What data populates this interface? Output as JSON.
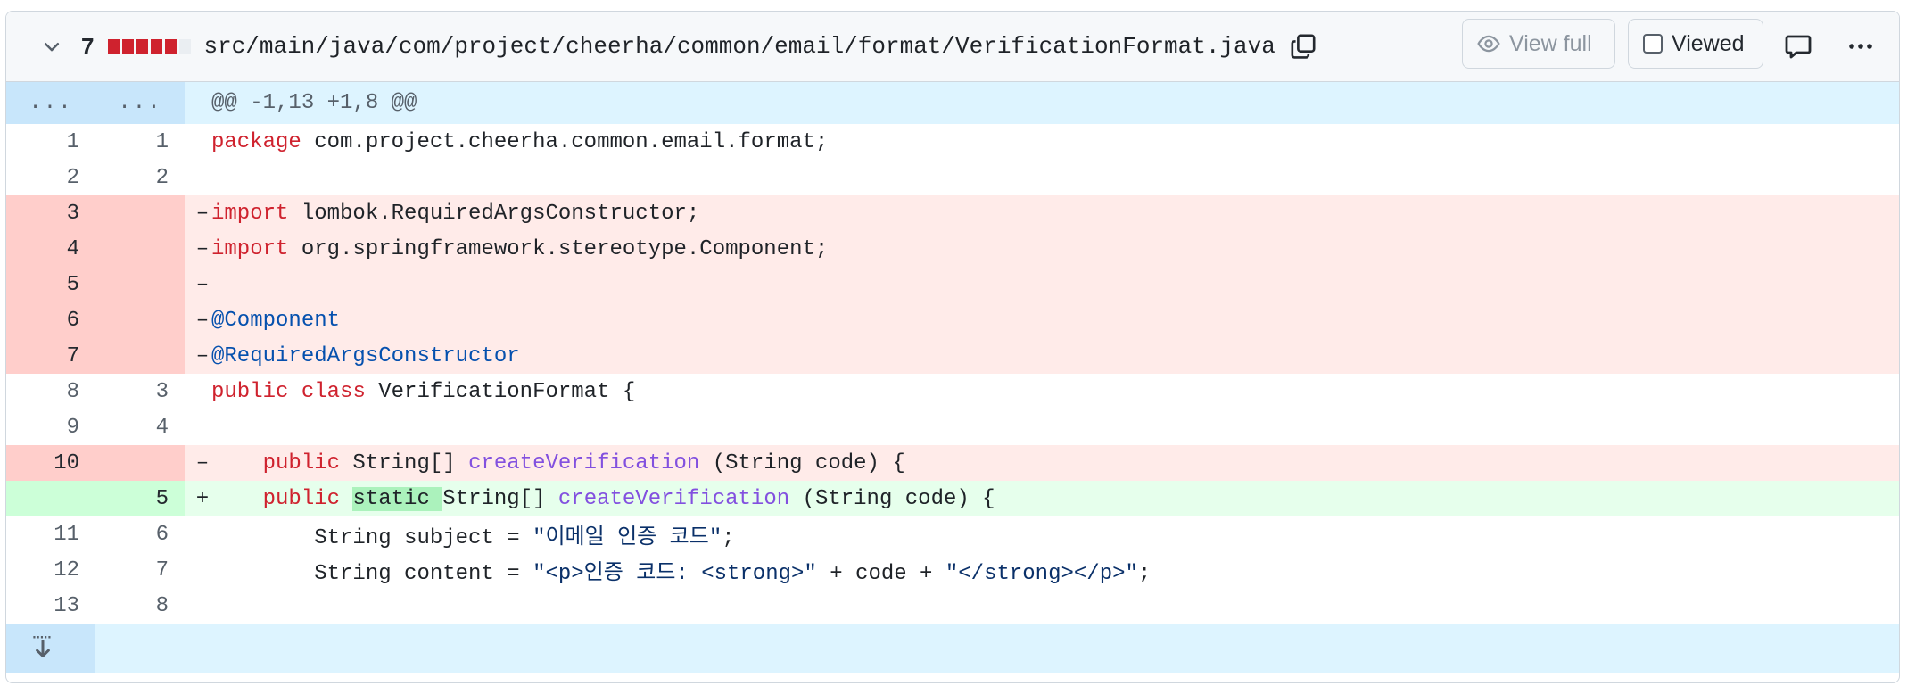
{
  "header": {
    "count": "7",
    "diffstat": [
      "#cf222e",
      "#cf222e",
      "#cf222e",
      "#cf222e",
      "#cf222e",
      "#eaeef2"
    ],
    "path": "src/main/java/com/project/cheerha/common/email/format/VerificationFormat.java",
    "view_full": "View full",
    "viewed": "Viewed",
    "icons": {
      "collapse": "chevron-down-icon",
      "copy": "copy-icon",
      "eye": "eye-icon",
      "comment": "comment-icon",
      "more": "kebab-horizontal-icon"
    }
  },
  "hunk": {
    "left": "...",
    "right": "...",
    "text": "@@ -1,13 +1,8 @@"
  },
  "lines": [
    {
      "type": "ctx",
      "old": "1",
      "new": "1",
      "sign": "",
      "code": [
        {
          "t": "package",
          "c": "kw"
        },
        {
          "t": " com.project.cheerha.common.email.format;"
        }
      ]
    },
    {
      "type": "ctx",
      "old": "2",
      "new": "2",
      "sign": "",
      "code": []
    },
    {
      "type": "del",
      "old": "3",
      "new": "",
      "sign": "–",
      "code": [
        {
          "t": "import",
          "c": "kw"
        },
        {
          "t": " lombok.RequiredArgsConstructor;"
        }
      ]
    },
    {
      "type": "del",
      "old": "4",
      "new": "",
      "sign": "–",
      "code": [
        {
          "t": "import",
          "c": "kw"
        },
        {
          "t": " org.springframework.stereotype.Component;"
        }
      ]
    },
    {
      "type": "del",
      "old": "5",
      "new": "",
      "sign": "–",
      "code": []
    },
    {
      "type": "del",
      "old": "6",
      "new": "",
      "sign": "–",
      "code": [
        {
          "t": "@Component",
          "c": "an"
        }
      ]
    },
    {
      "type": "del",
      "old": "7",
      "new": "",
      "sign": "–",
      "code": [
        {
          "t": "@RequiredArgsConstructor",
          "c": "an"
        }
      ]
    },
    {
      "type": "ctx",
      "old": "8",
      "new": "3",
      "sign": "",
      "code": [
        {
          "t": "public",
          "c": "kw"
        },
        {
          "t": " "
        },
        {
          "t": "class",
          "c": "kw"
        },
        {
          "t": " VerificationFormat {"
        }
      ]
    },
    {
      "type": "ctx",
      "old": "9",
      "new": "4",
      "sign": "",
      "code": []
    },
    {
      "type": "del",
      "old": "10",
      "new": "",
      "sign": "–",
      "code": [
        {
          "t": "    "
        },
        {
          "t": "public",
          "c": "kw"
        },
        {
          "t": " String[] "
        },
        {
          "t": "createVerification",
          "c": "fn"
        },
        {
          "t": " (String code) {"
        }
      ]
    },
    {
      "type": "add",
      "old": "",
      "new": "5",
      "sign": "+",
      "code": [
        {
          "t": "    "
        },
        {
          "t": "public",
          "c": "kw"
        },
        {
          "t": " "
        },
        {
          "t": "static ",
          "c": "hl"
        },
        {
          "t": "String[] "
        },
        {
          "t": "createVerification",
          "c": "fn"
        },
        {
          "t": " (String code) {"
        }
      ]
    },
    {
      "type": "ctx",
      "old": "11",
      "new": "6",
      "sign": "",
      "code": [
        {
          "t": "        String subject = "
        },
        {
          "t": "\"이메일 인증 코드\"",
          "c": "st"
        },
        {
          "t": ";"
        }
      ]
    },
    {
      "type": "ctx",
      "old": "12",
      "new": "7",
      "sign": "",
      "code": [
        {
          "t": "        String content = "
        },
        {
          "t": "\"<p>인증 코드: <strong>\"",
          "c": "st"
        },
        {
          "t": " + code + "
        },
        {
          "t": "\"</strong></p>\"",
          "c": "st"
        },
        {
          "t": ";"
        }
      ]
    },
    {
      "type": "ctx",
      "old": "13",
      "new": "8",
      "sign": "",
      "code": []
    }
  ],
  "expand": {
    "icon": "unfold-down-icon"
  }
}
